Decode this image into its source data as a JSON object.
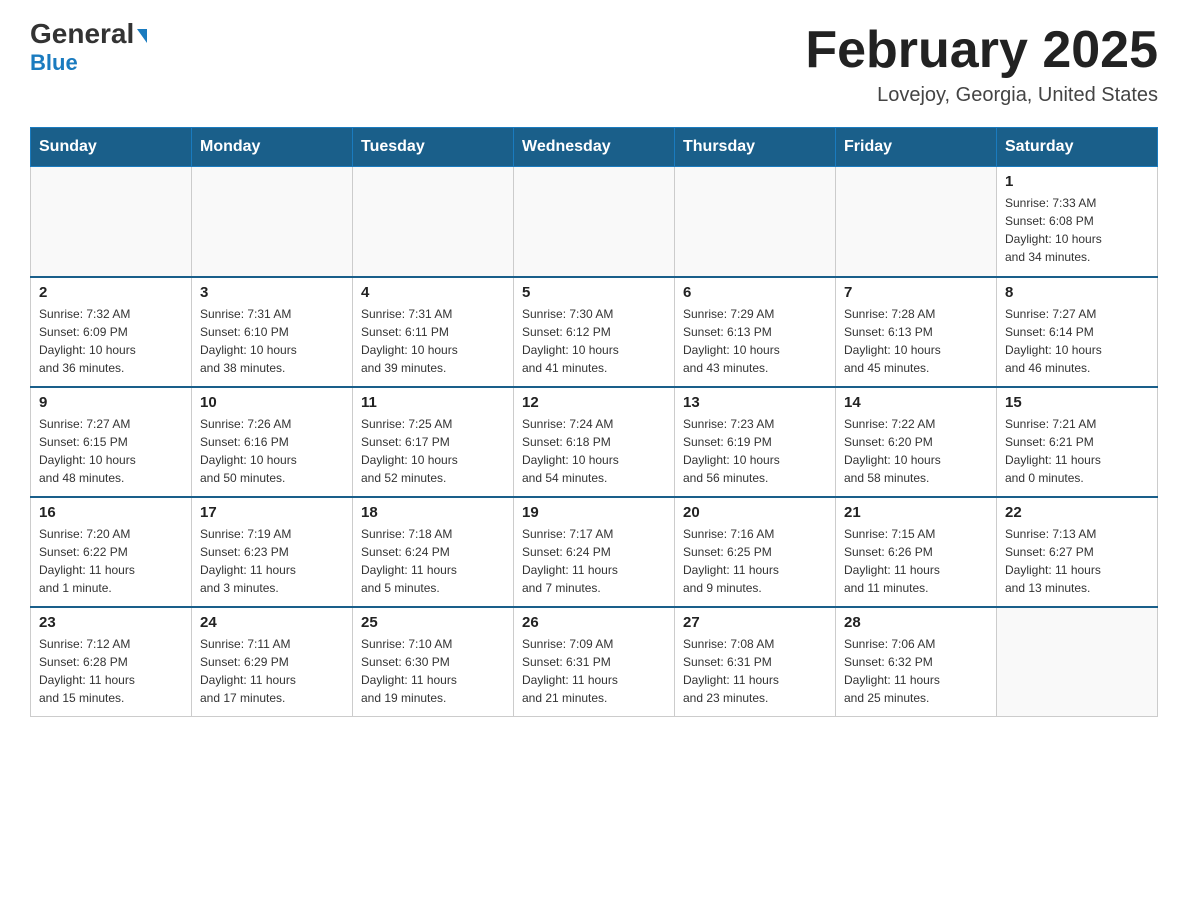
{
  "logo": {
    "general": "General",
    "arrow": "▶",
    "blue": "Blue"
  },
  "title": "February 2025",
  "subtitle": "Lovejoy, Georgia, United States",
  "headers": [
    "Sunday",
    "Monday",
    "Tuesday",
    "Wednesday",
    "Thursday",
    "Friday",
    "Saturday"
  ],
  "weeks": [
    [
      {
        "day": "",
        "info": ""
      },
      {
        "day": "",
        "info": ""
      },
      {
        "day": "",
        "info": ""
      },
      {
        "day": "",
        "info": ""
      },
      {
        "day": "",
        "info": ""
      },
      {
        "day": "",
        "info": ""
      },
      {
        "day": "1",
        "info": "Sunrise: 7:33 AM\nSunset: 6:08 PM\nDaylight: 10 hours\nand 34 minutes."
      }
    ],
    [
      {
        "day": "2",
        "info": "Sunrise: 7:32 AM\nSunset: 6:09 PM\nDaylight: 10 hours\nand 36 minutes."
      },
      {
        "day": "3",
        "info": "Sunrise: 7:31 AM\nSunset: 6:10 PM\nDaylight: 10 hours\nand 38 minutes."
      },
      {
        "day": "4",
        "info": "Sunrise: 7:31 AM\nSunset: 6:11 PM\nDaylight: 10 hours\nand 39 minutes."
      },
      {
        "day": "5",
        "info": "Sunrise: 7:30 AM\nSunset: 6:12 PM\nDaylight: 10 hours\nand 41 minutes."
      },
      {
        "day": "6",
        "info": "Sunrise: 7:29 AM\nSunset: 6:13 PM\nDaylight: 10 hours\nand 43 minutes."
      },
      {
        "day": "7",
        "info": "Sunrise: 7:28 AM\nSunset: 6:13 PM\nDaylight: 10 hours\nand 45 minutes."
      },
      {
        "day": "8",
        "info": "Sunrise: 7:27 AM\nSunset: 6:14 PM\nDaylight: 10 hours\nand 46 minutes."
      }
    ],
    [
      {
        "day": "9",
        "info": "Sunrise: 7:27 AM\nSunset: 6:15 PM\nDaylight: 10 hours\nand 48 minutes."
      },
      {
        "day": "10",
        "info": "Sunrise: 7:26 AM\nSunset: 6:16 PM\nDaylight: 10 hours\nand 50 minutes."
      },
      {
        "day": "11",
        "info": "Sunrise: 7:25 AM\nSunset: 6:17 PM\nDaylight: 10 hours\nand 52 minutes."
      },
      {
        "day": "12",
        "info": "Sunrise: 7:24 AM\nSunset: 6:18 PM\nDaylight: 10 hours\nand 54 minutes."
      },
      {
        "day": "13",
        "info": "Sunrise: 7:23 AM\nSunset: 6:19 PM\nDaylight: 10 hours\nand 56 minutes."
      },
      {
        "day": "14",
        "info": "Sunrise: 7:22 AM\nSunset: 6:20 PM\nDaylight: 10 hours\nand 58 minutes."
      },
      {
        "day": "15",
        "info": "Sunrise: 7:21 AM\nSunset: 6:21 PM\nDaylight: 11 hours\nand 0 minutes."
      }
    ],
    [
      {
        "day": "16",
        "info": "Sunrise: 7:20 AM\nSunset: 6:22 PM\nDaylight: 11 hours\nand 1 minute."
      },
      {
        "day": "17",
        "info": "Sunrise: 7:19 AM\nSunset: 6:23 PM\nDaylight: 11 hours\nand 3 minutes."
      },
      {
        "day": "18",
        "info": "Sunrise: 7:18 AM\nSunset: 6:24 PM\nDaylight: 11 hours\nand 5 minutes."
      },
      {
        "day": "19",
        "info": "Sunrise: 7:17 AM\nSunset: 6:24 PM\nDaylight: 11 hours\nand 7 minutes."
      },
      {
        "day": "20",
        "info": "Sunrise: 7:16 AM\nSunset: 6:25 PM\nDaylight: 11 hours\nand 9 minutes."
      },
      {
        "day": "21",
        "info": "Sunrise: 7:15 AM\nSunset: 6:26 PM\nDaylight: 11 hours\nand 11 minutes."
      },
      {
        "day": "22",
        "info": "Sunrise: 7:13 AM\nSunset: 6:27 PM\nDaylight: 11 hours\nand 13 minutes."
      }
    ],
    [
      {
        "day": "23",
        "info": "Sunrise: 7:12 AM\nSunset: 6:28 PM\nDaylight: 11 hours\nand 15 minutes."
      },
      {
        "day": "24",
        "info": "Sunrise: 7:11 AM\nSunset: 6:29 PM\nDaylight: 11 hours\nand 17 minutes."
      },
      {
        "day": "25",
        "info": "Sunrise: 7:10 AM\nSunset: 6:30 PM\nDaylight: 11 hours\nand 19 minutes."
      },
      {
        "day": "26",
        "info": "Sunrise: 7:09 AM\nSunset: 6:31 PM\nDaylight: 11 hours\nand 21 minutes."
      },
      {
        "day": "27",
        "info": "Sunrise: 7:08 AM\nSunset: 6:31 PM\nDaylight: 11 hours\nand 23 minutes."
      },
      {
        "day": "28",
        "info": "Sunrise: 7:06 AM\nSunset: 6:32 PM\nDaylight: 11 hours\nand 25 minutes."
      },
      {
        "day": "",
        "info": ""
      }
    ]
  ]
}
